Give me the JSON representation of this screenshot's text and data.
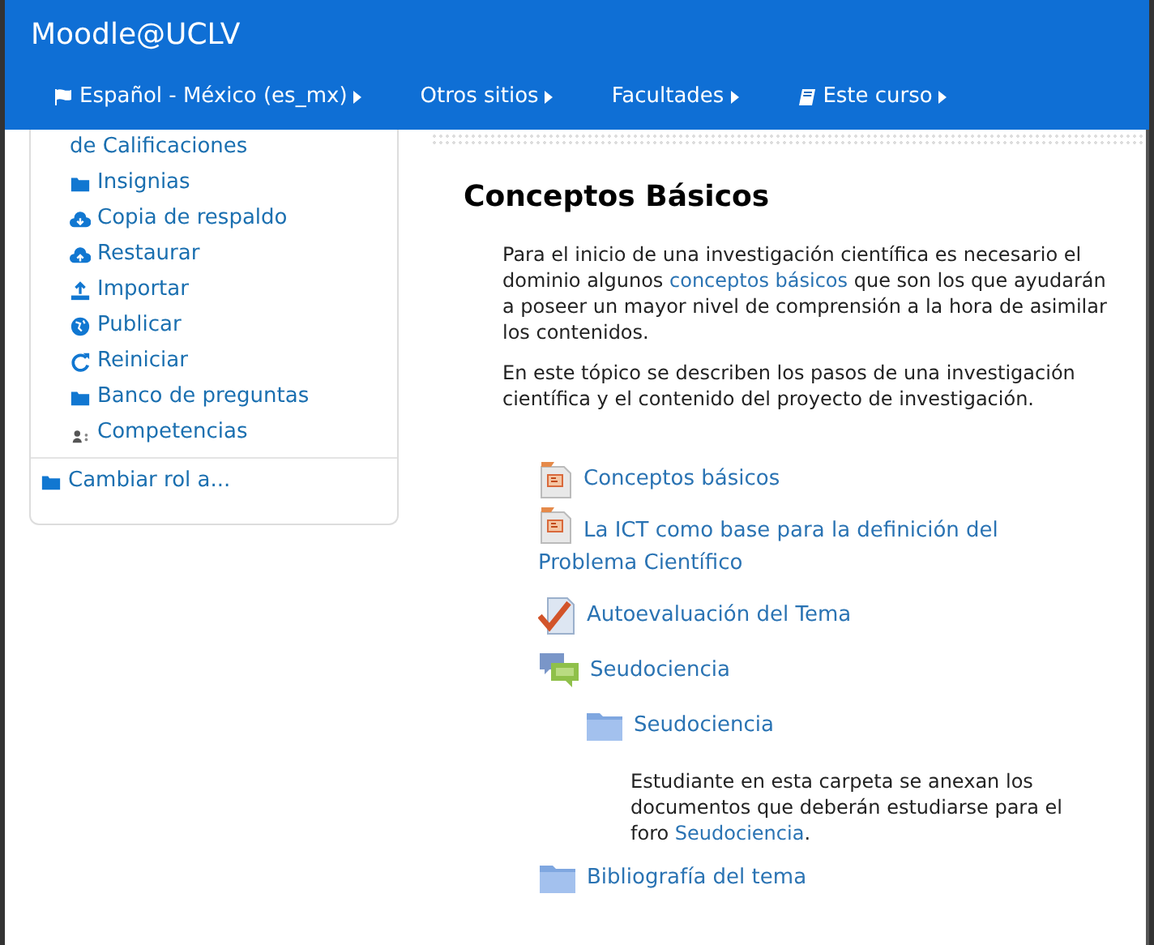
{
  "site_title": "Moodle@UCLV",
  "nav": [
    {
      "label": "Español - México (es_mx)",
      "kind": "flag"
    },
    {
      "label": "Otros sitios",
      "kind": "plain"
    },
    {
      "label": "Facultades",
      "kind": "plain"
    },
    {
      "label": "Este curso",
      "kind": "book"
    }
  ],
  "sidebar": {
    "items": [
      {
        "label": "de Calificaciones",
        "kind": "plain"
      },
      {
        "label": "Insignias",
        "kind": "folder"
      },
      {
        "label": "Copia de respaldo",
        "kind": "backup"
      },
      {
        "label": "Restaurar",
        "kind": "restore"
      },
      {
        "label": "Importar",
        "kind": "import"
      },
      {
        "label": "Publicar",
        "kind": "publish"
      },
      {
        "label": "Reiniciar",
        "kind": "reset"
      },
      {
        "label": "Banco de preguntas",
        "kind": "folder"
      },
      {
        "label": "Competencias",
        "kind": "competencies"
      }
    ],
    "footer_item": {
      "label": "Cambiar rol a...",
      "kind": "folder"
    }
  },
  "section": {
    "title": "Conceptos Básicos",
    "paragraphs": [
      {
        "before": "Para el inicio de una investigación científica es necesario el dominio algunos ",
        "link": "conceptos básicos",
        "after": " que son los que ayudarán a poseer un mayor nivel de comprensión a la hora de asimilar los contenidos."
      },
      {
        "before": "En este tópico se describen los pasos de una investigación científica y el contenido del proyecto de investigación."
      }
    ],
    "activities": [
      {
        "kind": "file",
        "label": "Conceptos básicos"
      },
      {
        "kind": "file",
        "label": "La ICT como base para la definición del Problema Científico"
      },
      {
        "kind": "quiz",
        "label": "Autoevaluación del Tema"
      },
      {
        "kind": "forum",
        "label": "Seudociencia",
        "children": [
          {
            "kind": "folder",
            "label": "Seudociencia",
            "description": {
              "before": "Estudiante en esta carpeta se anexan los documentos que deberán estudiarse para el foro ",
              "link": "Seudociencia",
              "after": "."
            }
          }
        ]
      },
      {
        "kind": "folder",
        "label": "Bibliografía del tema"
      }
    ]
  }
}
